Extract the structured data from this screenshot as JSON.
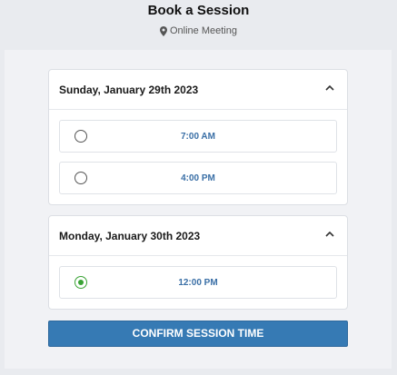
{
  "header": {
    "title": "Book a Session",
    "location_icon": "map-pin-icon",
    "location": "Online Meeting"
  },
  "days": [
    {
      "date": "Sunday, January 29th 2023",
      "expanded": true,
      "slots": [
        {
          "time": "7:00 AM",
          "selected": false
        },
        {
          "time": "4:00 PM",
          "selected": false
        }
      ]
    },
    {
      "date": "Monday, January 30th 2023",
      "expanded": true,
      "slots": [
        {
          "time": "12:00 PM",
          "selected": true
        }
      ]
    }
  ],
  "confirm_label": "CONFIRM SESSION TIME",
  "colors": {
    "accent": "#367ab4",
    "time_text": "#3a6fa6",
    "selected_radio": "#3aa335"
  }
}
